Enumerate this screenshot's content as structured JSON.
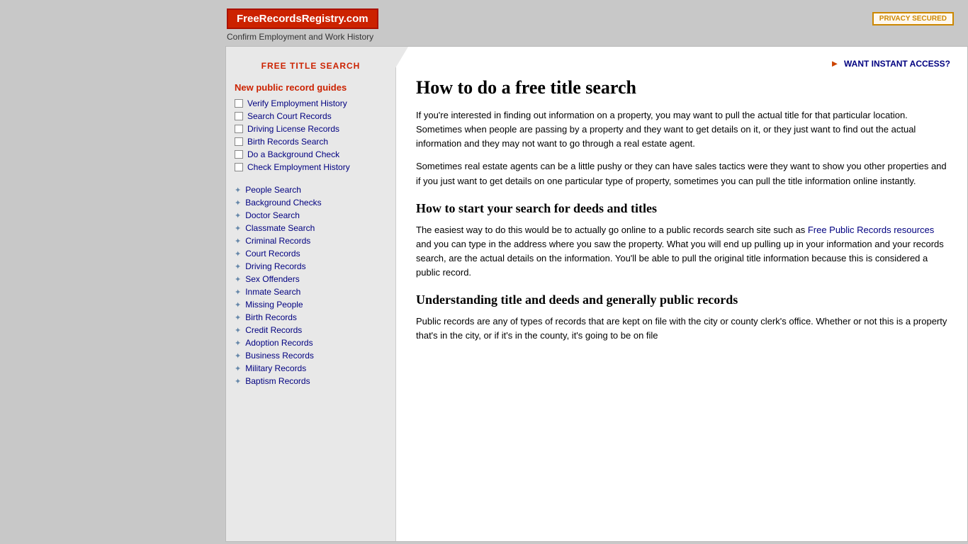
{
  "header": {
    "logo_text": "FreeRecordsRegistry.com",
    "tagline": "Confirm Employment and Work History",
    "privacy_badge": "PRIVACY  SECURED"
  },
  "sidebar": {
    "title": "FREE TITLE SEARCH",
    "new_guides_heading": "New public record guides",
    "guides": [
      {
        "label": "Verify Employment History"
      },
      {
        "label": "Search Court Records"
      },
      {
        "label": "Driving License Records"
      },
      {
        "label": "Birth Records Search"
      },
      {
        "label": "Do a Background Check"
      },
      {
        "label": "Check Employment History"
      }
    ],
    "secondary_links": [
      {
        "label": "People Search"
      },
      {
        "label": "Background Checks"
      },
      {
        "label": "Doctor Search"
      },
      {
        "label": "Classmate Search"
      },
      {
        "label": "Criminal Records"
      },
      {
        "label": "Court Records"
      },
      {
        "label": "Driving Records"
      },
      {
        "label": "Sex Offenders"
      },
      {
        "label": "Inmate Search"
      },
      {
        "label": "Missing People"
      },
      {
        "label": "Birth Records"
      },
      {
        "label": "Credit Records"
      },
      {
        "label": "Adoption Records"
      },
      {
        "label": "Business Records"
      },
      {
        "label": "Military Records"
      },
      {
        "label": "Baptism Records"
      }
    ]
  },
  "content": {
    "instant_access": "WANT INSTANT ACCESS?",
    "main_title": "How to do a free title search",
    "paragraphs": [
      "If you're interested in finding out information on a property, you may want to pull the actual title for that particular location. Sometimes when people are passing by a property and they want to get details on it, or they just want to find out the actual information and they may not want to go through a real estate agent.",
      "Sometimes real estate agents can be a little pushy or they can have sales tactics were they want to show you other properties and if you just want to get details on one particular type of property, sometimes you can pull the title information online instantly."
    ],
    "section1_title": "How to start your search for deeds and titles",
    "section1_para": "The easiest way to do this would be to actually go online to a public records search site such as ",
    "section1_link_text": "Free Public Records resources",
    "section1_para2": " and you can type in the address where you saw the property. What you will end up pulling up in your information and your records search, are the actual details on the information. You'll be able to pull the original title information because this is considered a public record.",
    "section2_title": "Understanding title and deeds and generally public records",
    "section2_para": "Public records are any of types of records that are kept on file with the city or county clerk's office. Whether or not this is a property that's in the city, or if it's in the county, it's going to be on file"
  }
}
